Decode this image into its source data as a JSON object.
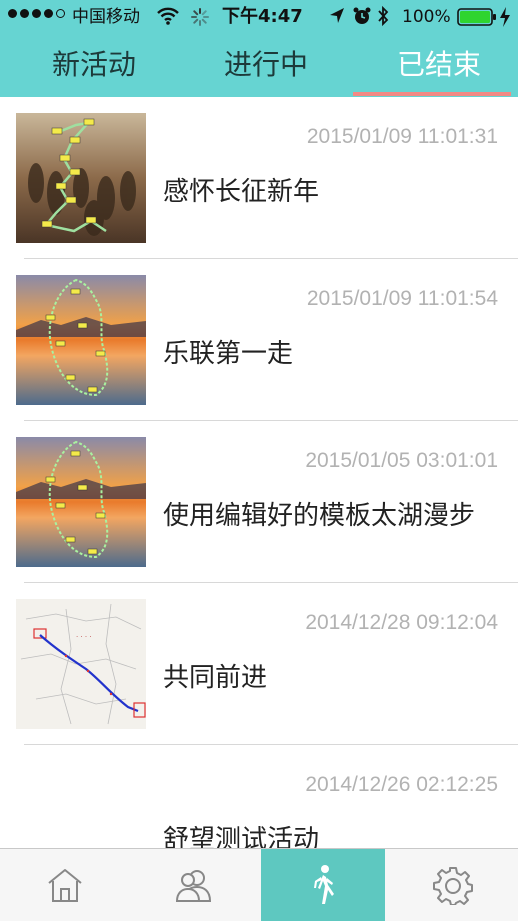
{
  "status_bar": {
    "carrier": "中国移动",
    "time": "下午4:47",
    "battery_percent": "100%",
    "signal_dots_filled": 4,
    "signal_dots_total": 5,
    "battery_level": 1.0
  },
  "tabs": [
    {
      "label": "新活动",
      "active": false
    },
    {
      "label": "进行中",
      "active": false
    },
    {
      "label": "已结束",
      "active": true
    }
  ],
  "colors": {
    "header_bg": "#66d4d2",
    "active_tab_underline": "#f28a85",
    "active_tabbar_bg": "#5ec8c0",
    "date_text": "#b2b2b2"
  },
  "activities": [
    {
      "date": "2015/01/09 11:01:31",
      "title": "感怀长征新年",
      "thumbnail": "long-march-painting-with-route-map"
    },
    {
      "date": "2015/01/09 11:01:54",
      "title": "乐联第一走",
      "thumbnail": "sunset-lake-with-route-map"
    },
    {
      "date": "2015/01/05 03:01:01",
      "title": "使用编辑好的模板太湖漫步",
      "thumbnail": "sunset-lake-with-route-map"
    },
    {
      "date": "2014/12/28 09:12:04",
      "title": "共同前进",
      "thumbnail": "china-map-with-blue-route"
    },
    {
      "date": "2014/12/26 02:12:25",
      "title": "舒望测试活动",
      "thumbnail": "none"
    }
  ],
  "tab_bar": [
    {
      "icon": "home-icon",
      "active": false
    },
    {
      "icon": "users-icon",
      "active": false
    },
    {
      "icon": "walking-person-icon",
      "active": true
    },
    {
      "icon": "gear-icon",
      "active": false
    }
  ]
}
